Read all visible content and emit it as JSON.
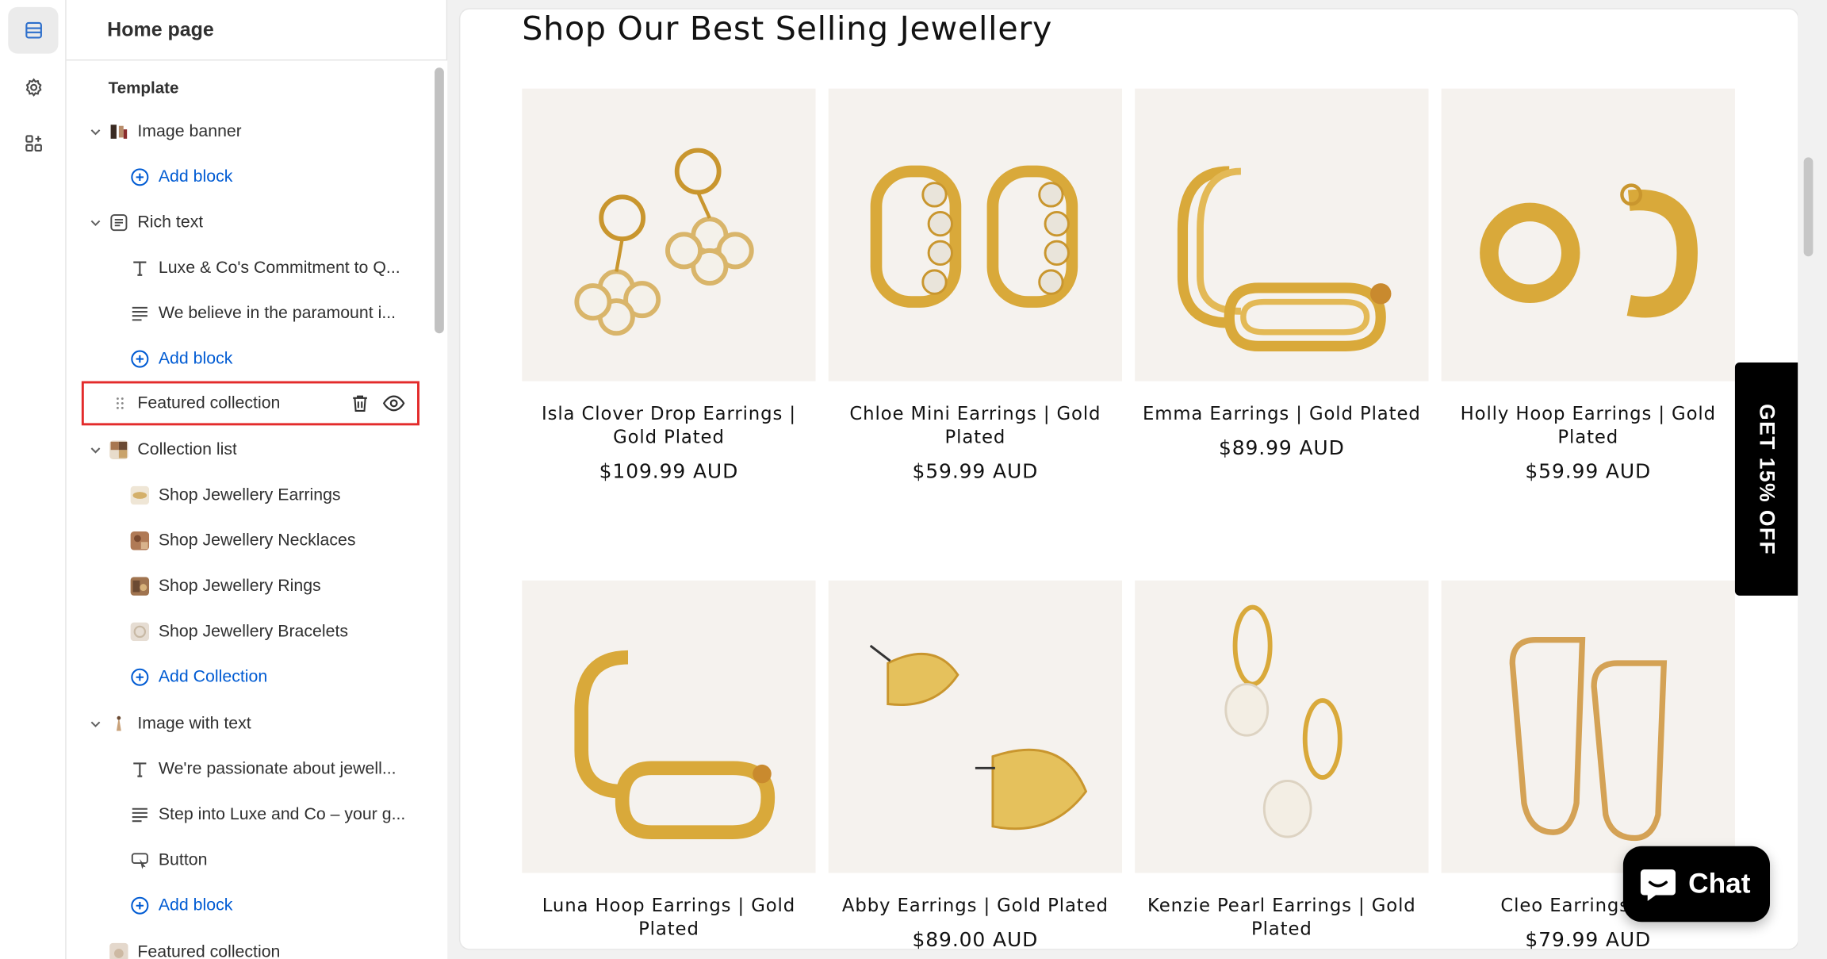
{
  "sidebar": {
    "title": "Home page",
    "template_label": "Template",
    "items": [
      {
        "label": "Image banner",
        "icon": "image-banner-thumbnail"
      },
      {
        "label": "Add block",
        "icon": "plus-circle-icon"
      },
      {
        "label": "Rich text",
        "icon": "rich-text-icon"
      },
      {
        "label": "Luxe & Co's Commitment to Q...",
        "icon": "heading-T-icon"
      },
      {
        "label": "We believe in the paramount i...",
        "icon": "paragraph-lines-icon"
      },
      {
        "label": "Add block",
        "icon": "plus-circle-icon"
      },
      {
        "label": "Featured collection",
        "icon": "drag-handle-icon"
      },
      {
        "label": "Collection list",
        "icon": "collection-thumbnail"
      },
      {
        "label": "Shop Jewellery Earrings",
        "icon": "earrings-thumbnail"
      },
      {
        "label": "Shop Jewellery Necklaces",
        "icon": "necklaces-thumbnail"
      },
      {
        "label": "Shop Jewellery Rings",
        "icon": "rings-thumbnail"
      },
      {
        "label": "Shop Jewellery Bracelets",
        "icon": "bracelets-thumbnail"
      },
      {
        "label": "Add Collection",
        "icon": "plus-circle-icon"
      },
      {
        "label": "Image with text",
        "icon": "image-with-text-thumbnail"
      },
      {
        "label": "We're passionate about jewell...",
        "icon": "heading-T-icon"
      },
      {
        "label": "Step into Luxe and Co – your g...",
        "icon": "paragraph-lines-icon"
      },
      {
        "label": "Button",
        "icon": "button-cursor-icon"
      },
      {
        "label": "Add block",
        "icon": "plus-circle-icon"
      },
      {
        "label": "Featured collection",
        "icon": "featured-collection-thumbnail"
      }
    ]
  },
  "preview": {
    "section_title": "Shop Our Best Selling Jewellery",
    "products": [
      {
        "title": "Isla Clover Drop Earrings | Gold Plated",
        "price": "$109.99 AUD"
      },
      {
        "title": "Chloe Mini Earrings | Gold Plated",
        "price": "$59.99 AUD"
      },
      {
        "title": "Emma Earrings | Gold Plated",
        "price": "$89.99 AUD"
      },
      {
        "title": "Holly Hoop Earrings | Gold Plated",
        "price": "$59.99 AUD"
      },
      {
        "title": "Luna Hoop Earrings | Gold Plated",
        "price": ""
      },
      {
        "title": "Abby Earrings | Gold Plated",
        "price": "$89.00 AUD"
      },
      {
        "title": "Kenzie Pearl Earrings | Gold Plated",
        "price": ""
      },
      {
        "title": "Cleo Earrings | Go",
        "price": "$79.99 AUD"
      }
    ],
    "promo_tab": "GET 15% OFF",
    "chat_label": "Chat"
  },
  "colors": {
    "accent_link": "#005bd3",
    "selection_outline": "#e32b2b",
    "gold": "#d9a93a",
    "product_bg": "#f5f2ee"
  }
}
